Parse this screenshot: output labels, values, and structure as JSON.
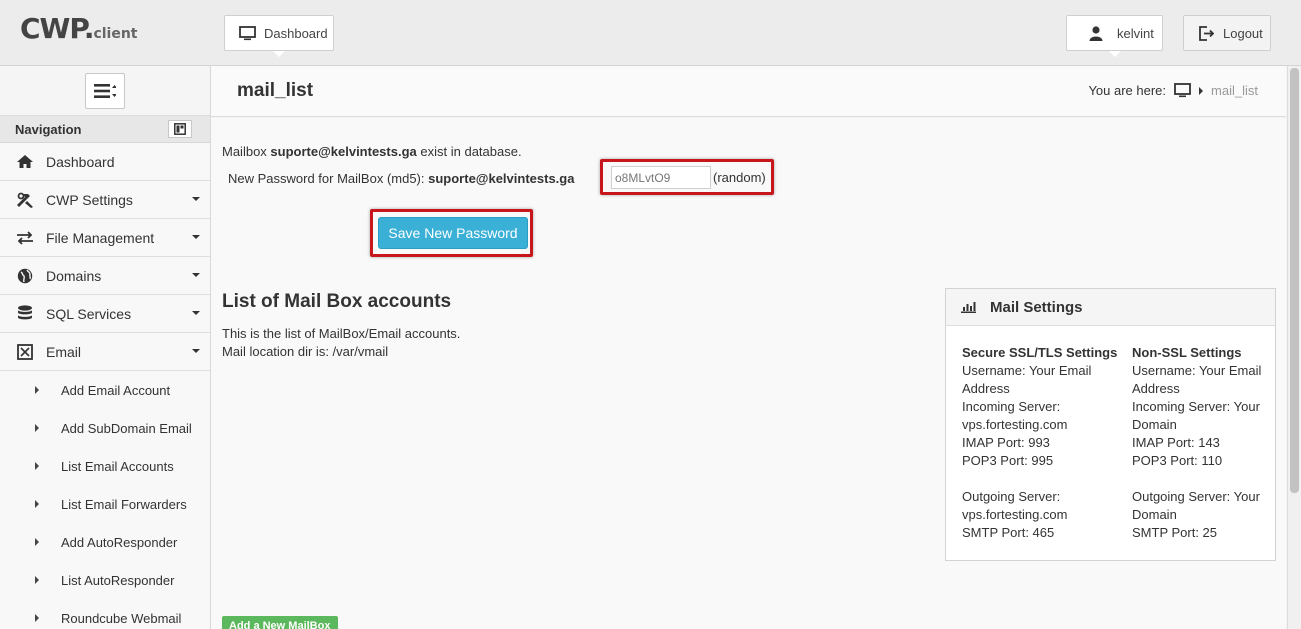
{
  "brand": {
    "name": "CWP.",
    "suffix": "client"
  },
  "header": {
    "dashboard_label": "Dashboard",
    "user_label": "kelvint",
    "logout_label": "Logout"
  },
  "sidebar": {
    "nav_heading": "Navigation",
    "items": [
      {
        "label": "Dashboard",
        "icon": "home-icon",
        "dropdown": false
      },
      {
        "label": "CWP Settings",
        "icon": "tools-icon",
        "dropdown": true
      },
      {
        "label": "File Management",
        "icon": "transfer-icon",
        "dropdown": true
      },
      {
        "label": "Domains",
        "icon": "globe-icon",
        "dropdown": true
      },
      {
        "label": "SQL Services",
        "icon": "database-icon",
        "dropdown": true
      },
      {
        "label": "Email",
        "icon": "envelope-icon",
        "dropdown": true
      }
    ],
    "email_subitems": [
      {
        "label": "Add Email Account"
      },
      {
        "label": "Add SubDomain Email"
      },
      {
        "label": "List Email Accounts"
      },
      {
        "label": "List Email Forwarders"
      },
      {
        "label": "Add AutoResponder"
      },
      {
        "label": "List AutoResponder"
      },
      {
        "label": "Roundcube Webmail"
      }
    ]
  },
  "page": {
    "title": "mail_list",
    "breadcrumb_prefix": "You are here:",
    "breadcrumb_current": "mail_list"
  },
  "mailbox": {
    "exist_prefix": "Mailbox",
    "address": "suporte@kelvintests.ga",
    "exist_suffix": "exist in database.",
    "new_password_label": "New Password for MailBox (md5):",
    "password_value": "o8MLvtO9",
    "random_label": "(random)",
    "save_button": "Save New Password"
  },
  "list": {
    "title": "List of Mail Box accounts",
    "desc1": "This is the list of MailBox/Email accounts.",
    "desc2": "Mail location dir is: /var/vmail",
    "add_button": "Add a New MailBox"
  },
  "mail_settings": {
    "title": "Mail Settings",
    "secure": {
      "heading": "Secure SSL/TLS Settings",
      "username": "Username: Your Email Address",
      "incoming": "Incoming Server: vps.fortesting.com",
      "imap": "IMAP Port: 993",
      "pop3": "POP3 Port: 995",
      "outgoing": "Outgoing Server: vps.fortesting.com",
      "smtp": "SMTP Port: 465"
    },
    "nonssl": {
      "heading": "Non-SSL Settings",
      "username": "Username: Your Email Address",
      "incoming": "Incoming Server: Your Domain",
      "imap": "IMAP Port: 143",
      "pop3": "POP3 Port: 110",
      "outgoing": "Outgoing Server: Your Domain",
      "smtp": "SMTP Port: 25"
    }
  },
  "colors": {
    "accent": "#3ab0d6",
    "highlight": "#c8161d",
    "add_button": "#5cb85c"
  }
}
